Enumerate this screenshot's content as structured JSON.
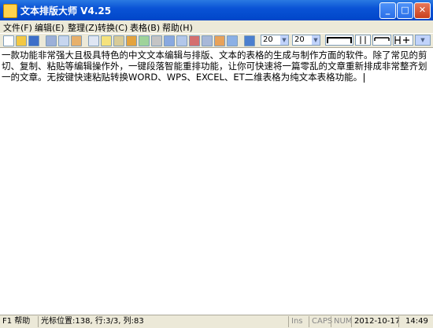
{
  "window": {
    "title": "文本排版大师 V4.25",
    "controls": [
      "_",
      "□",
      "✕"
    ]
  },
  "menu": [
    "文件(F)",
    "编辑(E)",
    "整理(Z)",
    "转换(C)",
    "表格(B)",
    "帮助(H)"
  ],
  "toolbar": {
    "font_size_1": "20",
    "font_size_2": "20"
  },
  "editor": {
    "content": "一款功能非常强大且极具特色的中文文本编辑与排版、文本的表格的生成与制作方面的软件。除了常见的剪切、复制、粘贴等编辑操作外，一键段落智能重排功能，让你可快速将一篇零乱的文章重新排成非常整齐划一的文章。无按键快速粘贴转换WORD、WPS、EXCEL、ET二维表格为纯文本表格功能。"
  },
  "status": {
    "help": "F1 帮助",
    "cursor": "光标位置:138, 行:3/3, 列:83",
    "ins": "Ins",
    "caps": "CAPS",
    "num": "NUM",
    "date": "2012-10-17",
    "time": "14:49"
  }
}
